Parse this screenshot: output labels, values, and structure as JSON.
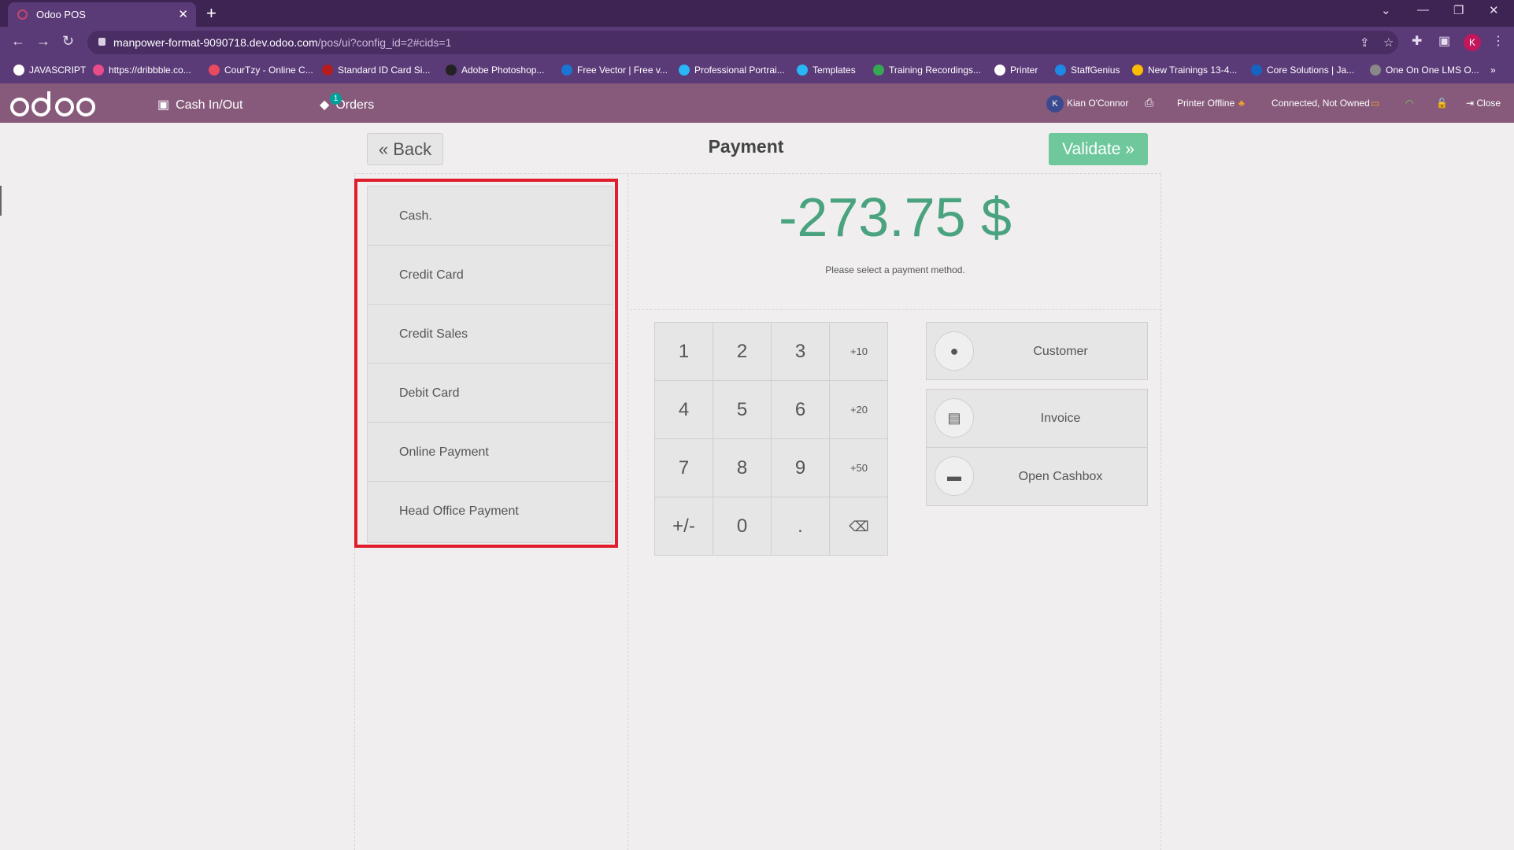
{
  "browser": {
    "tab_title": "Odoo POS",
    "url_host": "manpower-format-9090718.dev.odoo.com",
    "url_path": "/pos/ui?config_id=2#cids=1",
    "profile_initial": "K",
    "bookmarks": [
      {
        "label": "JAVASCRIPT",
        "color": "#ffffff"
      },
      {
        "label": "https://dribbble.co...",
        "color": "#ea4c89"
      },
      {
        "label": "CourTzy - Online C...",
        "color": "#e84a5f"
      },
      {
        "label": "Standard ID Card Si...",
        "color": "#b71c1c"
      },
      {
        "label": "Adobe Photoshop...",
        "color": "#222222"
      },
      {
        "label": "Free Vector | Free v...",
        "color": "#1976d2"
      },
      {
        "label": "Professional Portrai...",
        "color": "#29b6f6"
      },
      {
        "label": "Templates",
        "color": "#29b6f6"
      },
      {
        "label": "Training Recordings...",
        "color": "#34a853"
      },
      {
        "label": "Printer",
        "color": "#ffffff"
      },
      {
        "label": "StaffGenius",
        "color": "#1e88e5"
      },
      {
        "label": "New Trainings 13-4...",
        "color": "#fbbc04"
      },
      {
        "label": "Core Solutions | Ja...",
        "color": "#1565c0"
      },
      {
        "label": "One On One LMS O...",
        "color": "#888888"
      }
    ]
  },
  "navbar": {
    "logo": "odoo",
    "cash_label": "Cash In/Out",
    "orders_label": "Orders",
    "orders_badge": "1",
    "user_initial": "K",
    "user_name": "Kian O'Connor",
    "printer_status": "Printer Offline",
    "connection_status": "Connected, Not Owned",
    "close_label": "Close"
  },
  "payment": {
    "back_label": "Back",
    "title": "Payment",
    "validate_label": "Validate",
    "amount": "-273.75 $",
    "hint": "Please select a payment method.",
    "methods": [
      "Cash.",
      "Credit Card",
      "Credit Sales",
      "Debit Card",
      "Online Payment",
      "Head Office Payment"
    ],
    "numpad": [
      "1",
      "2",
      "3",
      "+10",
      "4",
      "5",
      "6",
      "+20",
      "7",
      "8",
      "9",
      "+50",
      "+/-",
      "0",
      ".",
      "⌫"
    ],
    "customer_label": "Customer",
    "invoice_label": "Invoice",
    "cashbox_label": "Open Cashbox"
  },
  "colors": {
    "navbar": "#875a7b",
    "amount": "#4aa37f",
    "validate": "#6ec89b",
    "highlight": "#e01e2b"
  }
}
